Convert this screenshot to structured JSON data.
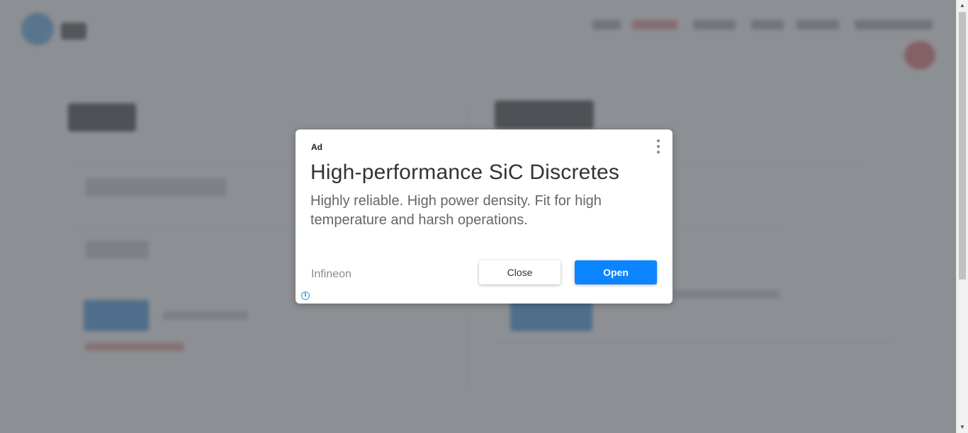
{
  "ad": {
    "label": "Ad",
    "headline": "High-performance SiC Discretes",
    "body": "Highly reliable. High power density. Fit for high temperature and harsh operations.",
    "advertiser": "Infineon",
    "close_label": "Close",
    "open_label": "Open",
    "info_glyph": "i",
    "menu_icon": "more-vertical-icon"
  },
  "colors": {
    "overlay": "#60646a",
    "open_button": "#0a84ff",
    "info_icon": "#1aa3d9"
  },
  "scrollbar": {
    "up_glyph": "▲",
    "down_glyph": "▼"
  }
}
